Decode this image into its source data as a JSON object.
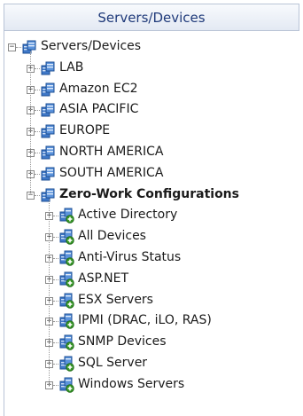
{
  "header": {
    "title": "Servers/Devices"
  },
  "tree": {
    "root": {
      "label": "Servers/Devices",
      "icon": "server-group-icon",
      "state": "expanded"
    },
    "groups": [
      {
        "label": "LAB",
        "icon": "server-group-icon",
        "state": "collapsed"
      },
      {
        "label": "Amazon EC2",
        "icon": "server-group-icon",
        "state": "collapsed"
      },
      {
        "label": "ASIA PACIFIC",
        "icon": "server-group-icon",
        "state": "collapsed"
      },
      {
        "label": "EUROPE",
        "icon": "server-group-icon",
        "state": "collapsed"
      },
      {
        "label": "NORTH AMERICA",
        "icon": "server-group-icon",
        "state": "collapsed"
      },
      {
        "label": "SOUTH AMERICA",
        "icon": "server-group-icon",
        "state": "collapsed"
      },
      {
        "label": "Zero-Work Configurations",
        "icon": "server-group-icon",
        "state": "expanded"
      }
    ],
    "zero_work_children": [
      {
        "label": "Active Directory",
        "icon": "config-group-icon",
        "state": "collapsed"
      },
      {
        "label": "All Devices",
        "icon": "config-group-icon",
        "state": "collapsed"
      },
      {
        "label": "Anti-Virus Status",
        "icon": "config-group-icon",
        "state": "collapsed"
      },
      {
        "label": "ASP.NET",
        "icon": "config-group-icon",
        "state": "collapsed"
      },
      {
        "label": "ESX Servers",
        "icon": "config-group-icon",
        "state": "collapsed"
      },
      {
        "label": "IPMI (DRAC, iLO, RAS)",
        "icon": "config-group-icon",
        "state": "collapsed"
      },
      {
        "label": "SNMP Devices",
        "icon": "config-group-icon",
        "state": "collapsed"
      },
      {
        "label": "SQL Server",
        "icon": "config-group-icon",
        "state": "collapsed"
      },
      {
        "label": "Windows Servers",
        "icon": "config-group-icon",
        "state": "collapsed"
      }
    ]
  },
  "colors": {
    "header_text": "#1f3a7a",
    "border": "#b9c4d6",
    "icon_blue": "#2f6fc2",
    "icon_green": "#3a9a2a"
  }
}
